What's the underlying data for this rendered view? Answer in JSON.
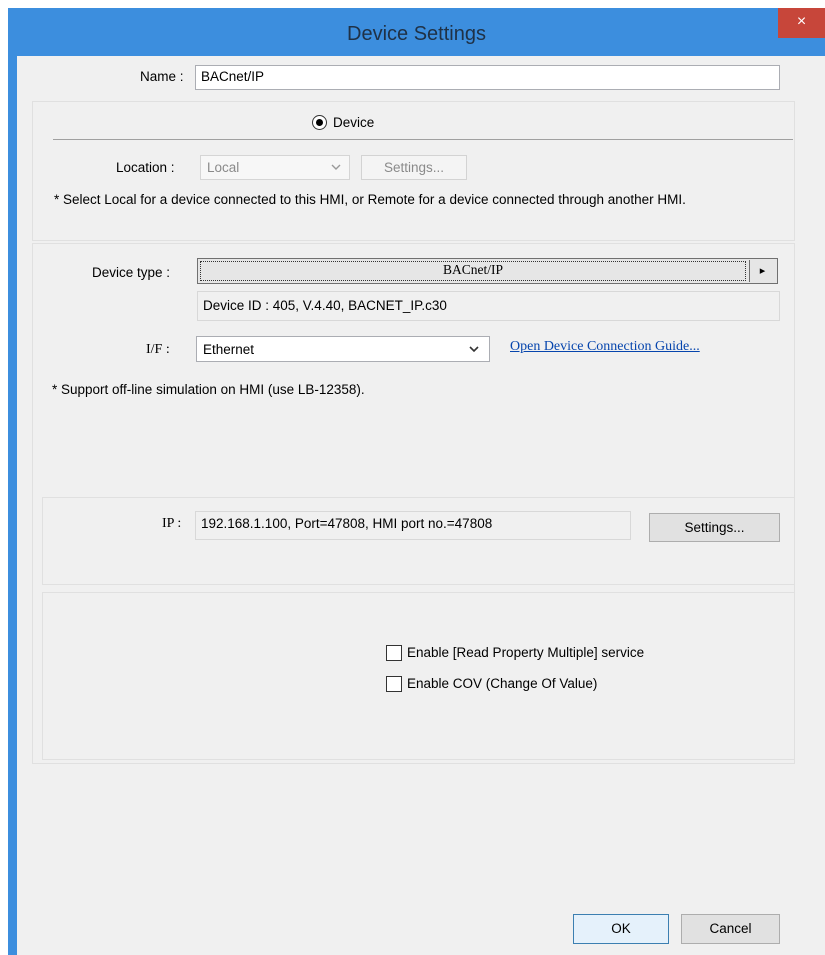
{
  "window": {
    "title": "Device Settings",
    "close_glyph": "×"
  },
  "name": {
    "label": "Name :",
    "value": "BACnet/IP"
  },
  "device_radio": {
    "label": "Device"
  },
  "location": {
    "label": "Location :",
    "value": "Local",
    "settings_label": "Settings..."
  },
  "location_note": "* Select Local for a device connected to this HMI, or Remote for a device connected through another HMI.",
  "device_type": {
    "label": "Device type :",
    "value": "BACnet/IP",
    "arrow_glyph": "▸"
  },
  "device_id": "Device ID : 405, V.4.40, BACNET_IP.c30",
  "interface": {
    "label": "I/F :",
    "value": "Ethernet",
    "guide_link": "Open Device Connection Guide..."
  },
  "sim_note": "* Support off-line simulation on HMI (use LB-12358).",
  "ip": {
    "label": "IP :",
    "value": "192.168.1.100,  Port=47808, HMI port no.=47808",
    "settings_label": "Settings..."
  },
  "options": [
    {
      "label": "Enable [Read Property Multiple] service",
      "checked": false
    },
    {
      "label": "Enable COV (Change Of Value)",
      "checked": false
    }
  ],
  "footer": {
    "ok_label": "OK",
    "cancel_label": "Cancel"
  },
  "colors": {
    "titlebar": "#3c8ede",
    "close": "#c7463a",
    "client": "#f0f0f0"
  },
  "icons": {
    "dropdown": "chevron-down-icon",
    "arrow": "triangle-right-icon"
  }
}
